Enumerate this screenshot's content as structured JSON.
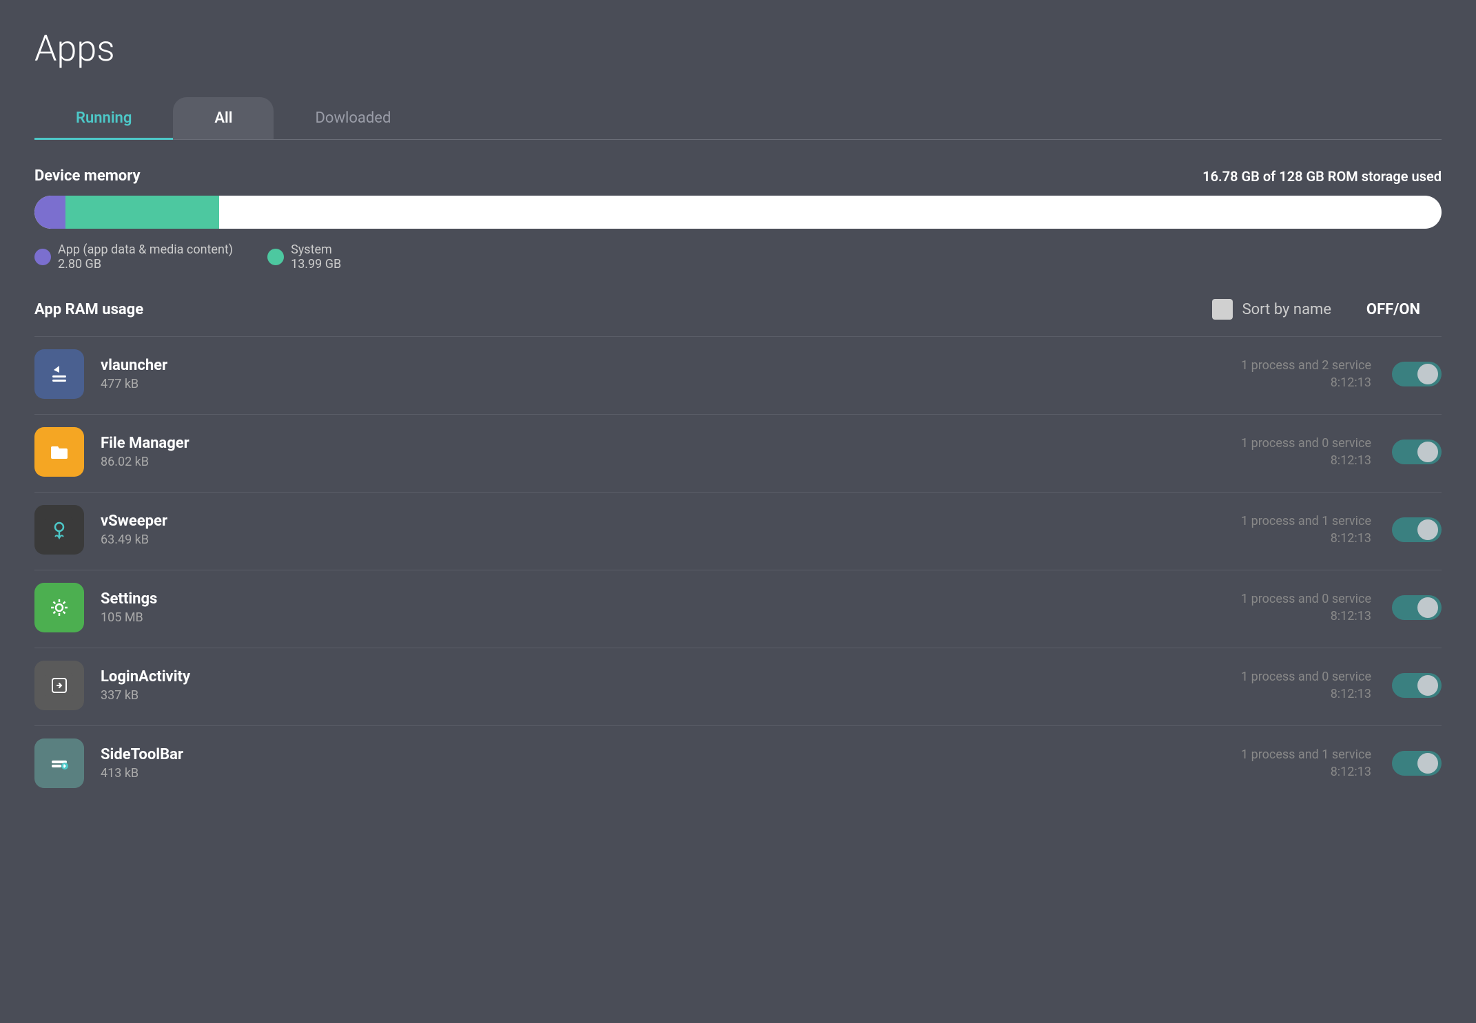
{
  "page": {
    "title": "Apps"
  },
  "tabs": [
    {
      "id": "running",
      "label": "Running",
      "active": true
    },
    {
      "id": "all",
      "label": "All",
      "active": false
    },
    {
      "id": "downloaded",
      "label": "Dowloaded",
      "active": false
    }
  ],
  "deviceMemory": {
    "label": "Device memory",
    "info": "16.78 GB of 128 GB ROM storage used",
    "appPercent": 2.19,
    "systemPercent": 10.93,
    "legend": {
      "app": {
        "label": "App (app data & media content)",
        "size": "2.80 GB"
      },
      "system": {
        "label": "System",
        "size": "13.99 GB"
      }
    }
  },
  "appRam": {
    "title": "App RAM usage",
    "sortByName": "Sort by name",
    "offOnLabel": "OFF/ON"
  },
  "apps": [
    {
      "id": "vlauncher",
      "name": "vlauncher",
      "size": "477 kB",
      "process": "1 process and 2 service",
      "time": "8:12:13",
      "toggleOn": true,
      "iconType": "vlauncher"
    },
    {
      "id": "filemanager",
      "name": "File Manager",
      "size": "86.02 kB",
      "process": "1 process and 0 service",
      "time": "8:12:13",
      "toggleOn": true,
      "iconType": "filemanager"
    },
    {
      "id": "vsweeper",
      "name": "vSweeper",
      "size": "63.49 kB",
      "process": "1 process and 1 service",
      "time": "8:12:13",
      "toggleOn": true,
      "iconType": "vsweeper"
    },
    {
      "id": "settings",
      "name": "Settings",
      "size": "105 MB",
      "process": "1 process and 0 service",
      "time": "8:12:13",
      "toggleOn": true,
      "iconType": "settings"
    },
    {
      "id": "loginactivity",
      "name": "LoginActivity",
      "size": "337 kB",
      "process": "1 process and 0 service",
      "time": "8:12:13",
      "toggleOn": true,
      "iconType": "loginactivity"
    },
    {
      "id": "sidetoolbar",
      "name": "SideToolBar",
      "size": "413 kB",
      "process": "1 process and 1 service",
      "time": "8:12:13",
      "toggleOn": true,
      "iconType": "sidetoolbar"
    }
  ]
}
